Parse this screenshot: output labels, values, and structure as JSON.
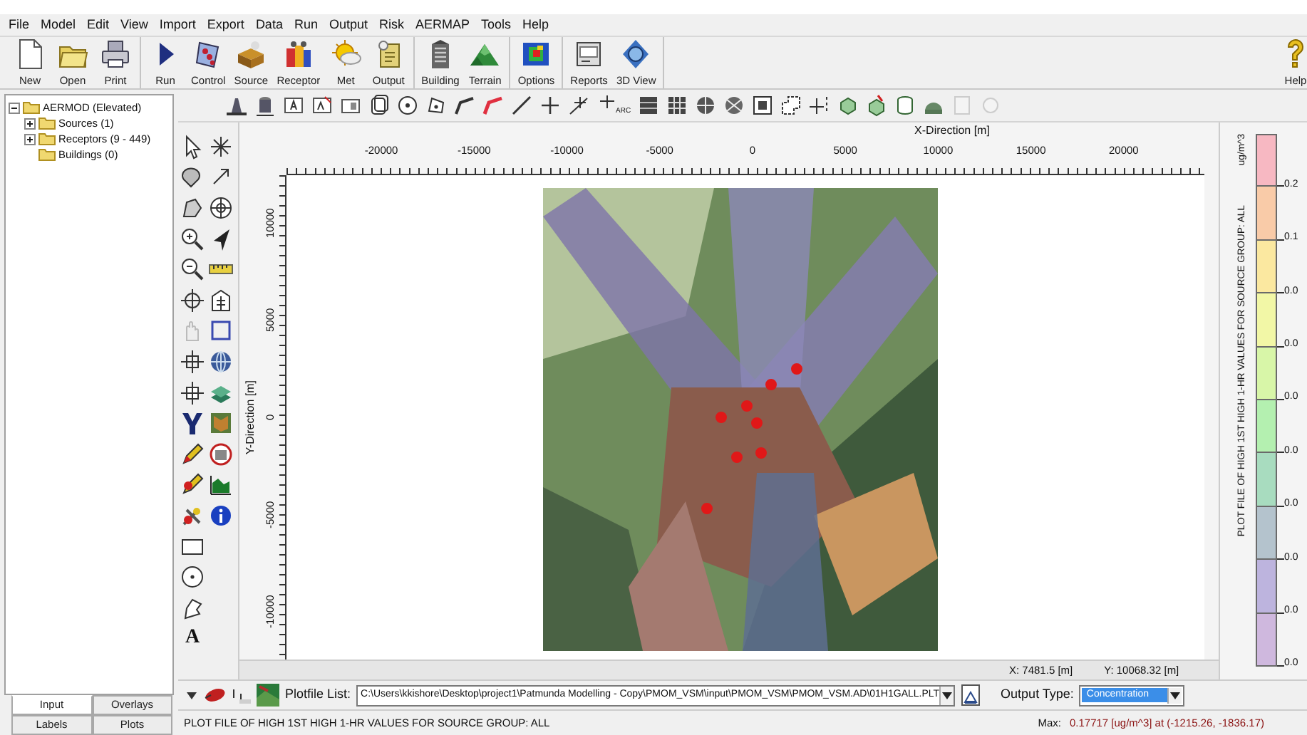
{
  "menu": [
    "File",
    "Model",
    "Edit",
    "View",
    "Import",
    "Export",
    "Data",
    "Run",
    "Output",
    "Risk",
    "AERMAP",
    "Tools",
    "Help"
  ],
  "toolbar": {
    "groups": [
      [
        "New",
        "Open",
        "Print"
      ],
      [
        "Run",
        "Control",
        "Source",
        "Receptor",
        "Met",
        "Output"
      ],
      [
        "Building",
        "Terrain"
      ],
      [
        "Options"
      ],
      [
        "Reports",
        "3D View"
      ]
    ],
    "help": "Help"
  },
  "draw_toolbar": {
    "arc_label": "ARC"
  },
  "tree": {
    "label": "AERMOD (Elevated)",
    "expanded": true,
    "children": [
      {
        "label": "Sources (1)",
        "expanded": false
      },
      {
        "label": "Receptors (9 - 449)",
        "expanded": false
      },
      {
        "label": "Buildings (0)"
      }
    ]
  },
  "panel_tabs": [
    {
      "label": "Input",
      "selected": true
    },
    {
      "label": "Overlays",
      "selected": false
    },
    {
      "label": "Labels",
      "selected": false
    },
    {
      "label": "Plots",
      "selected": false
    }
  ],
  "palette": {
    "text_tool": "A"
  },
  "plot": {
    "x_axis": {
      "title": "X-Direction [m]",
      "ticks": [
        "-20000",
        "-15000",
        "-10000",
        "-5000",
        "0",
        "5000",
        "10000",
        "15000",
        "20000"
      ]
    },
    "y_axis": {
      "title": "Y-Direction [m]",
      "ticks": [
        "10000",
        "5000",
        "0",
        "-5000",
        "-10000"
      ]
    },
    "cursor_x": "X: 7481.5 [m]",
    "cursor_y": "Y: 10068.32 [m]"
  },
  "legend": {
    "unit": "ug/m^3",
    "title": "PLOT FILE OF HIGH 1ST HIGH 1-HR VALUES FOR SOURCE GROUP: ALL",
    "items": [
      {
        "color": "#f7b8c2",
        "label": "0.2"
      },
      {
        "color": "#f9cba8",
        "label": "0.1"
      },
      {
        "color": "#fbe8a0",
        "label": "0.0"
      },
      {
        "color": "#f2f7a6",
        "label": "0.0"
      },
      {
        "color": "#d8f6a8",
        "label": "0.0"
      },
      {
        "color": "#b4f0b0",
        "label": "0.0"
      },
      {
        "color": "#a8dcbf",
        "label": "0.0"
      },
      {
        "color": "#b4c3cd",
        "label": "0.0"
      },
      {
        "color": "#bdb4de",
        "label": "0.0"
      },
      {
        "color": "#cfb8de",
        "label": "0.0"
      }
    ]
  },
  "plotfile": {
    "label": "Plotfile List:",
    "path": "C:\\Users\\kkishore\\Desktop\\project1\\Patmunda Modelling - Copy\\PMOM_VSM\\input\\PMOM_VSM\\PMOM_VSM.AD\\01H1GALL.PLT",
    "output_type_label": "Output Type:",
    "output_type": "Concentration"
  },
  "status_bar": {
    "text": "PLOT FILE OF HIGH 1ST HIGH 1-HR VALUES FOR SOURCE GROUP: ALL",
    "max_label": "Max:",
    "max_value": "0.17717 [ug/m^3] at (-1215.26, -1836.17)"
  }
}
